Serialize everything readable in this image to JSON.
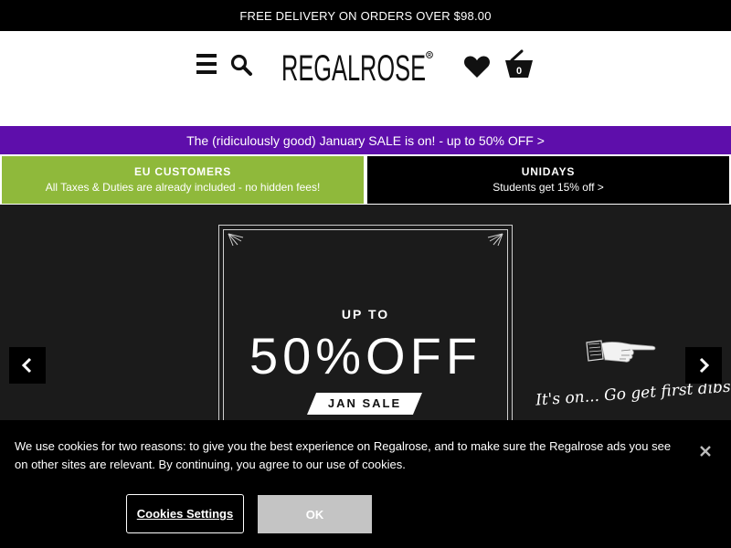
{
  "topbar": {
    "text": "FREE DELIVERY ON ORDERS OVER $98.00"
  },
  "header": {
    "logo_text": "REGALROSE",
    "basket_count": "0",
    "icons": [
      "menu-icon",
      "search-icon",
      "heart-icon",
      "basket-icon"
    ]
  },
  "promo": {
    "text": "The (ridiculously good) January SALE is on! - up to 50% OFF >"
  },
  "info": {
    "eu": {
      "title": "EU CUSTOMERS",
      "sub": "All Taxes & Duties are already included - no hidden fees!"
    },
    "unidays": {
      "title": "UNIDAYS",
      "sub": "Students get 15% off >"
    }
  },
  "hero": {
    "up_to": "UP TO",
    "off": "50%OFF",
    "badge": "JAN SALE",
    "tagline": "It's on... Go get first dibs!",
    "icons": [
      "chevron-left-icon",
      "chevron-right-icon",
      "pointing-hand-icon"
    ]
  },
  "cookie": {
    "text": "We use cookies for two reasons: to give you the best experience on Regalrose, and to make sure the Regalrose ads you see on other sites are relevant. By continuing, you agree to our use of cookies.",
    "settings_label": "Cookies Settings",
    "ok_label": "OK",
    "close_icon": "close-icon"
  },
  "colors": {
    "promo_purple": "#5e0eab",
    "eu_green": "#8fb93b",
    "hero_bg": "#1b1b1b",
    "ok_button": "#c4c4c4"
  }
}
